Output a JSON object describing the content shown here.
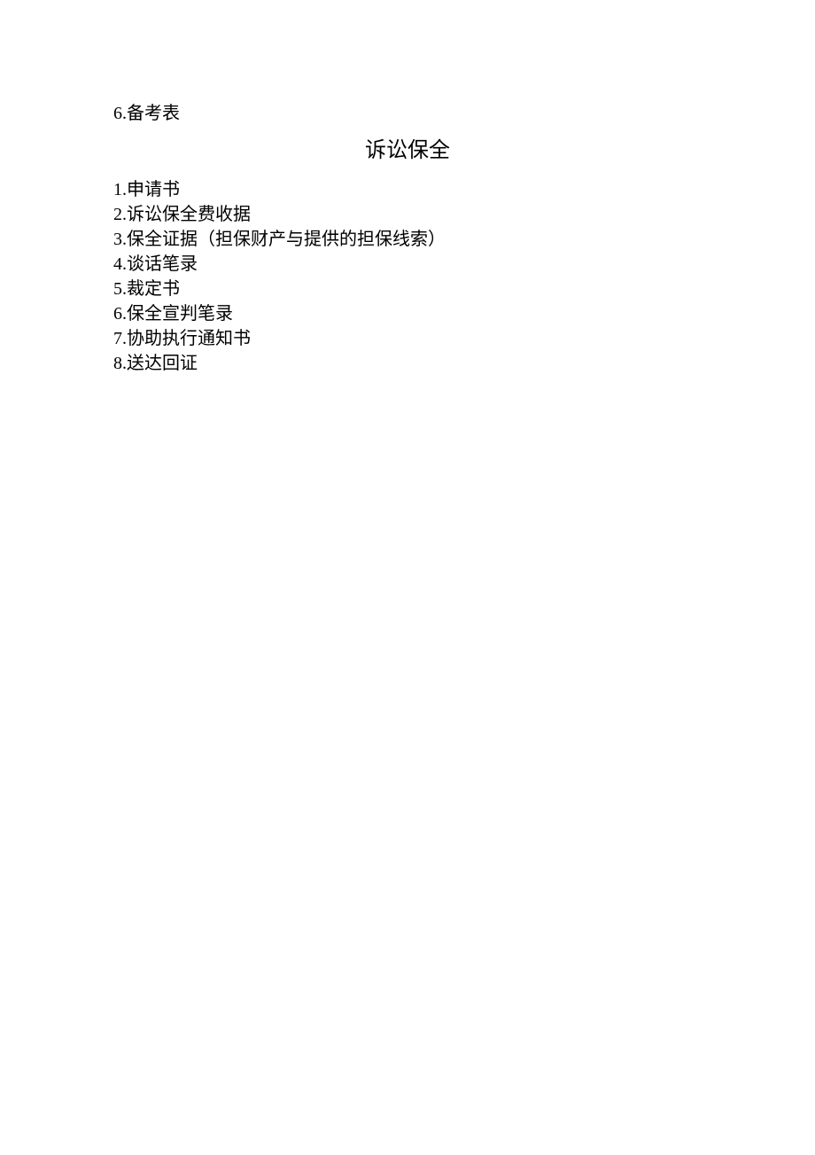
{
  "preceding_item": {
    "num": "6.",
    "text": "备考表"
  },
  "title": "诉讼保全",
  "items": [
    {
      "num": "1.",
      "text": "申请书"
    },
    {
      "num": "2.",
      "text": "诉讼保全费收据"
    },
    {
      "num": "3.",
      "text": "保全证据（担保财产与提供的担保线索）"
    },
    {
      "num": "4.",
      "text": "谈话笔录"
    },
    {
      "num": "5.",
      "text": "裁定书"
    },
    {
      "num": "6.",
      "text": "保全宣判笔录"
    },
    {
      "num": "7.",
      "text": "协助执行通知书"
    },
    {
      "num": "8.",
      "text": "送达回证"
    }
  ]
}
